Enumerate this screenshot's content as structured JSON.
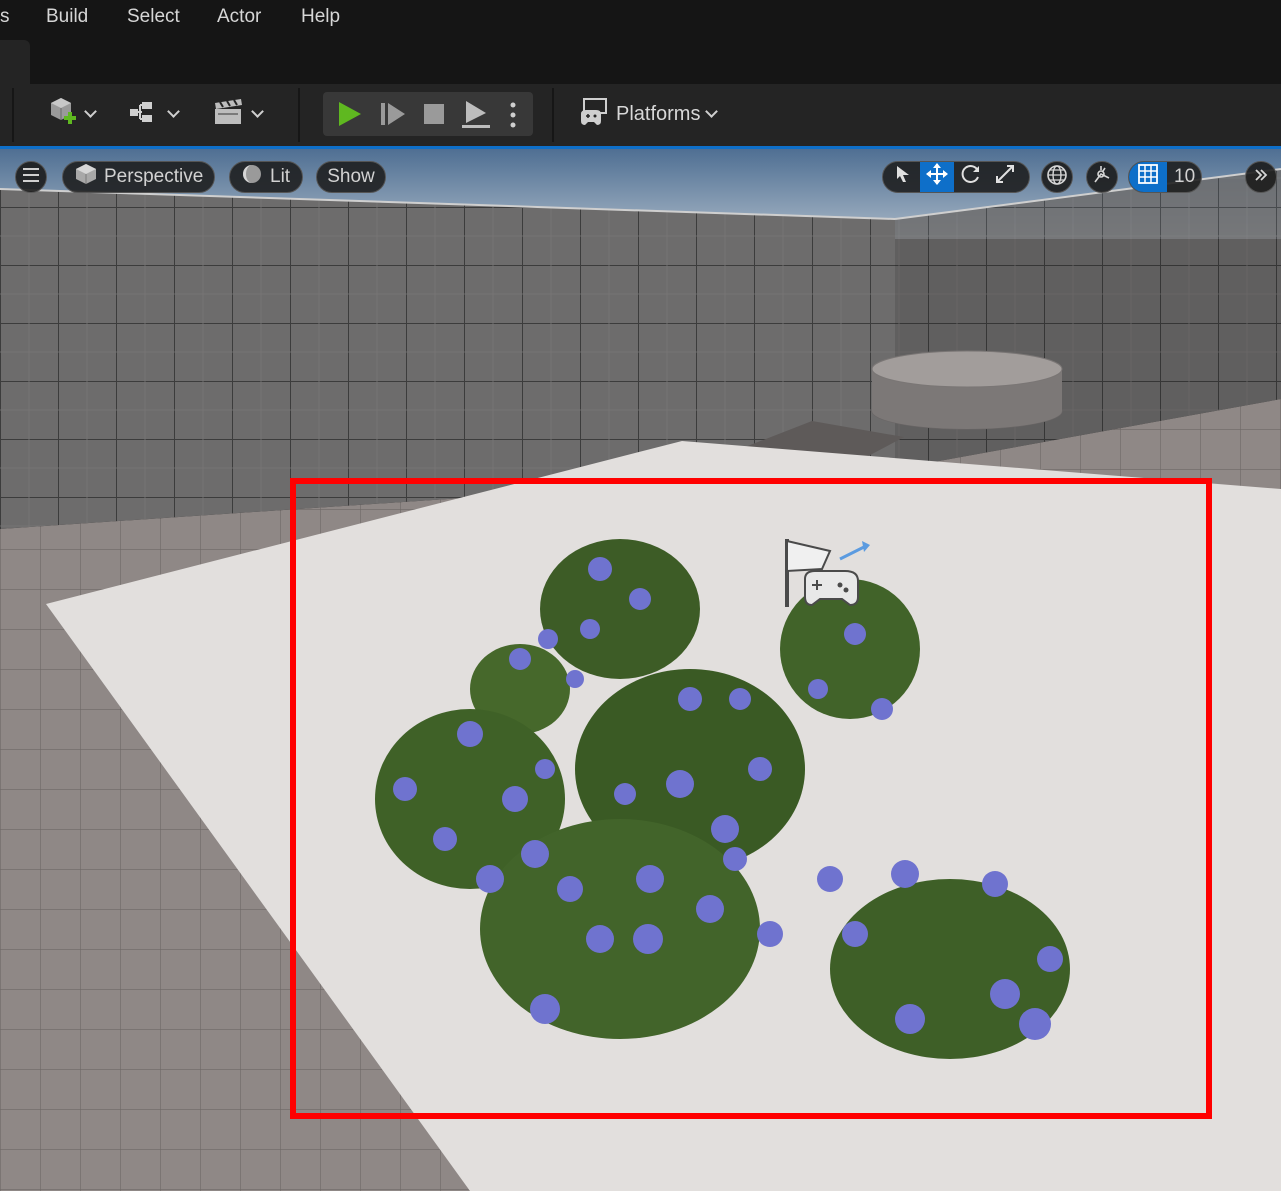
{
  "menu": {
    "items": [
      "s",
      "Build",
      "Select",
      "Actor",
      "Help"
    ]
  },
  "toolbar": {
    "icons": [
      "add-actor-icon",
      "blueprint-icon",
      "cinematics-icon"
    ],
    "play_controls": [
      "play-icon",
      "advance-frame-icon",
      "stop-icon",
      "eject-icon",
      "more-options-icon"
    ],
    "platforms_label": "Platforms"
  },
  "viewport": {
    "menu_icon": "hamburger-icon",
    "perspective_label": "Perspective",
    "lit_label": "Lit",
    "show_label": "Show",
    "transform_tools": [
      "select-icon",
      "translate-icon",
      "rotate-icon",
      "scale-icon"
    ],
    "grid_snap_value": "10",
    "highlight_color": "#ff0000",
    "accent_color": "#0e6fc9",
    "play_color": "#5fb820"
  }
}
